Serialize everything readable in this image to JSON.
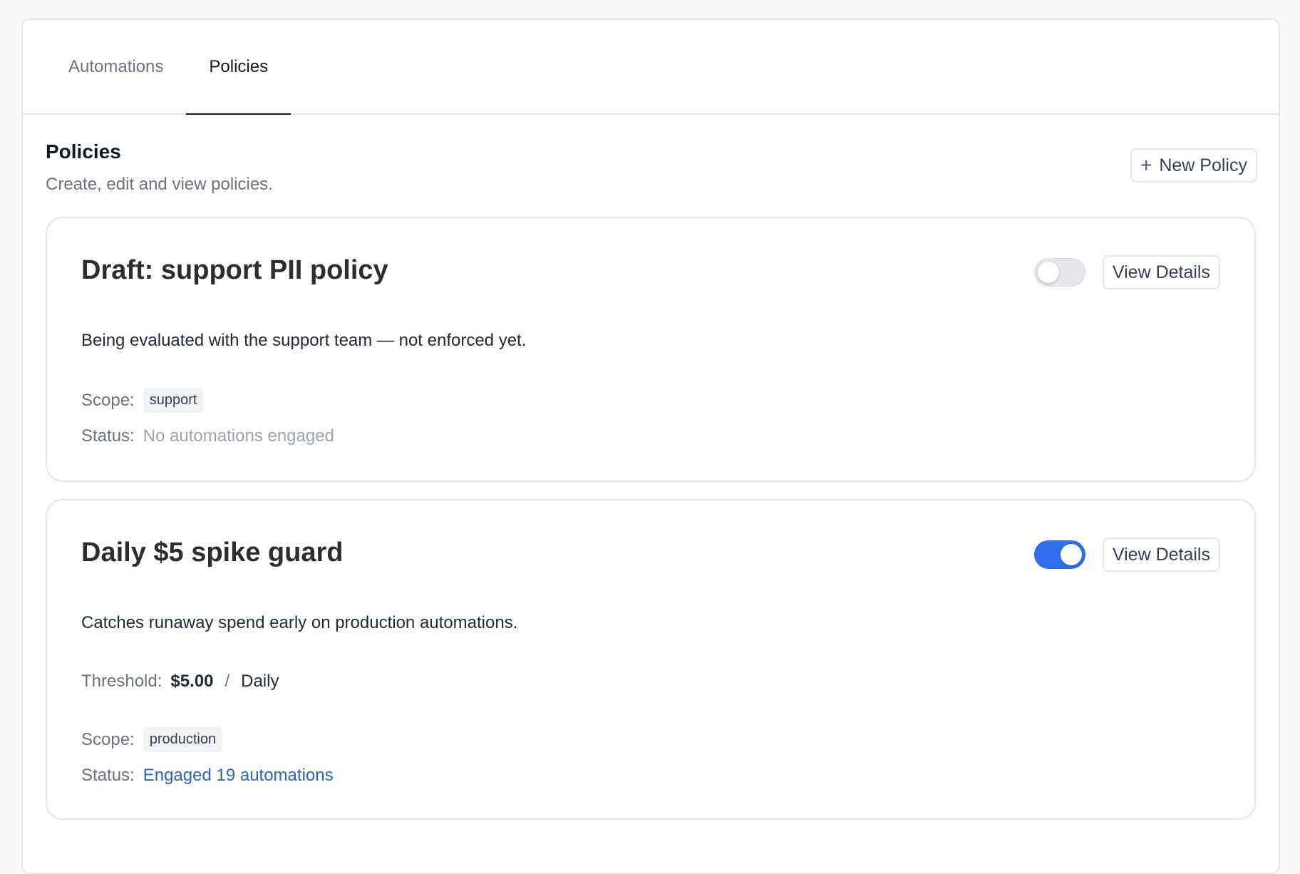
{
  "tabs": [
    {
      "label": "Automations",
      "active": false
    },
    {
      "label": "Policies",
      "active": true
    }
  ],
  "section": {
    "title": "Policies",
    "description": "Create, edit and view policies.",
    "new_button_label": "New Policy"
  },
  "policies": [
    {
      "title": "Draft: support PII policy",
      "enabled": false,
      "view_details_label": "View Details",
      "description": "Being evaluated with the support team — not enforced yet.",
      "scope_label": "Scope:",
      "scope": "support",
      "status_label": "Status:",
      "status": "No automations engaged"
    },
    {
      "title": "Daily $5 spike guard",
      "enabled": true,
      "view_details_label": "View Details",
      "description": "Catches runaway spend early on production automations.",
      "threshold_label": "Threshold:",
      "threshold_amount": "$5.00",
      "threshold_separator": "/",
      "threshold_period": "Daily",
      "scope_label": "Scope:",
      "scope": "production",
      "status_label": "Status:",
      "status": "Engaged 19 automations"
    }
  ],
  "colors": {
    "accent": "#2f6fed",
    "link": "#2f5fd0",
    "muted": "#9ca3af"
  }
}
